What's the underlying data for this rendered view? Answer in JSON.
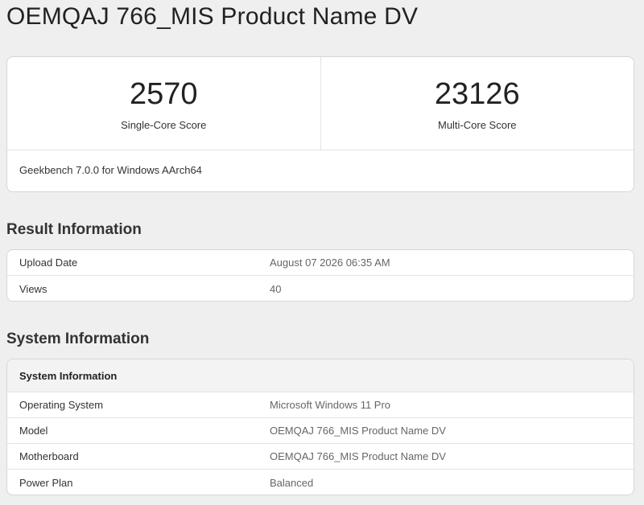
{
  "page_title": "OEMQAJ 766_MIS Product Name DV",
  "scores": {
    "single_core": {
      "value": "2570",
      "label": "Single-Core Score"
    },
    "multi_core": {
      "value": "23126",
      "label": "Multi-Core Score"
    },
    "platform": "Geekbench 7.0.0 for Windows AArch64"
  },
  "result_information": {
    "title": "Result Information",
    "rows": [
      {
        "key": "Upload Date",
        "value": "August 07 2026 06:35 AM"
      },
      {
        "key": "Views",
        "value": "40"
      }
    ]
  },
  "system_information": {
    "title": "System Information",
    "table_header": "System Information",
    "rows": [
      {
        "key": "Operating System",
        "value": "Microsoft Windows 11 Pro"
      },
      {
        "key": "Model",
        "value": "OEMQAJ 766_MIS Product Name DV"
      },
      {
        "key": "Motherboard",
        "value": "OEMQAJ 766_MIS Product Name DV"
      },
      {
        "key": "Power Plan",
        "value": "Balanced"
      }
    ]
  }
}
